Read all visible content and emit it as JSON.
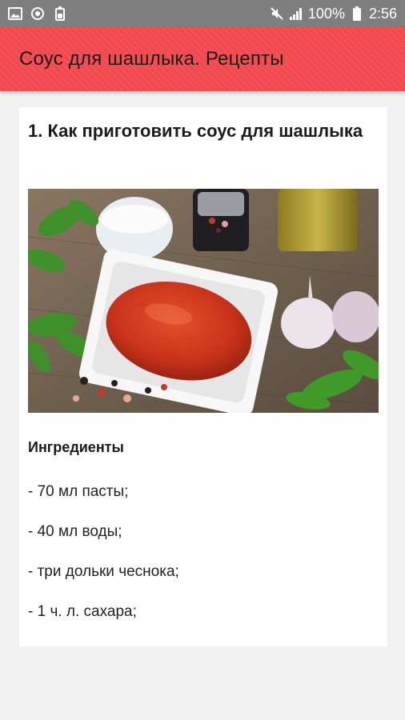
{
  "status_bar": {
    "battery_percent": "100%",
    "time": "2:56",
    "icons": [
      "gallery-icon",
      "sync-icon",
      "battery-saver-icon",
      "mute-icon",
      "signal-icon",
      "battery-icon"
    ]
  },
  "app_bar": {
    "title": "Соус для шашлыка. Рецепты",
    "color": "#f2494f"
  },
  "recipe": {
    "title": "1. Как приготовить соус для шашлыка",
    "section_heading": "Ингредиенты",
    "ingredients": [
      "- 70 мл пасты;",
      "- 40 мл воды;",
      "- три дольки чеснока;",
      "- 1 ч. л. сахара;"
    ]
  }
}
